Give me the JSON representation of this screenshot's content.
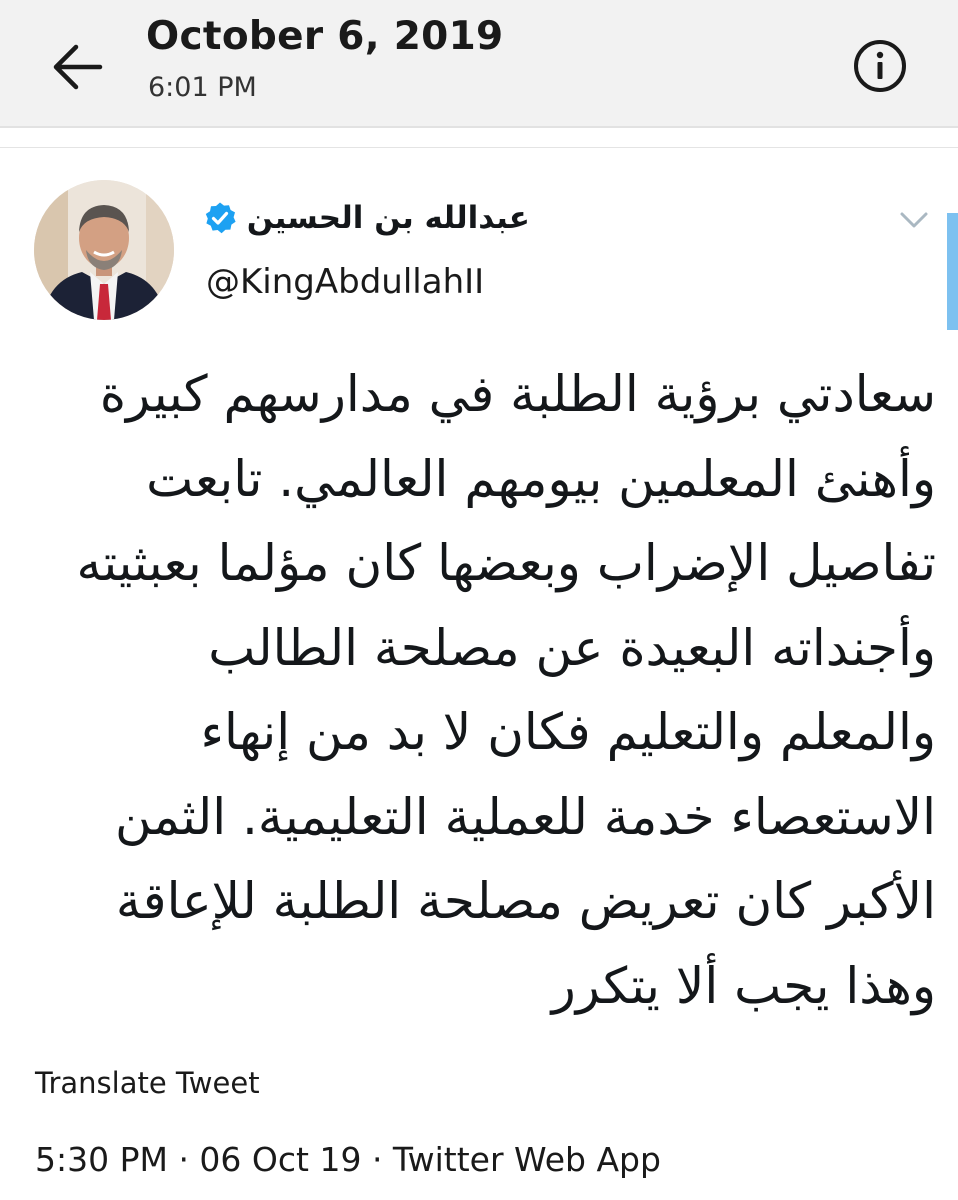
{
  "header": {
    "date": "October 6, 2019",
    "time": "6:01 PM",
    "back_icon": "arrow-left-icon",
    "info_icon": "info-circle-icon"
  },
  "tweet": {
    "display_name": "عبدالله بن الحسين",
    "handle": "@KingAbdullahII",
    "verified_icon": "verified-badge-icon",
    "verified_color": "#1da1f2",
    "caret_icon": "chevron-down-icon",
    "lines": [
      "سعادتي برؤية الطلبة في مدارسهم كبيرة",
      "وأهنئ المعلمين بيومهم العالمي. تابعت",
      "تفاصيل الإضراب وبعضها كان مؤلما بعبثيته",
      "وأجنداته البعيدة عن مصلحة الطالب",
      "والمعلم والتعليم فكان لا بد من إنهاء",
      "الاستعصاء خدمة للعملية التعليمية. الثمن",
      "الأكبر كان تعريض مصلحة الطلبة للإعاقة",
      "وهذا يجب ألا يتكرر"
    ],
    "translate_label": "Translate Tweet",
    "meta": "5:30 PM · 06 Oct 19 · Twitter Web App"
  }
}
